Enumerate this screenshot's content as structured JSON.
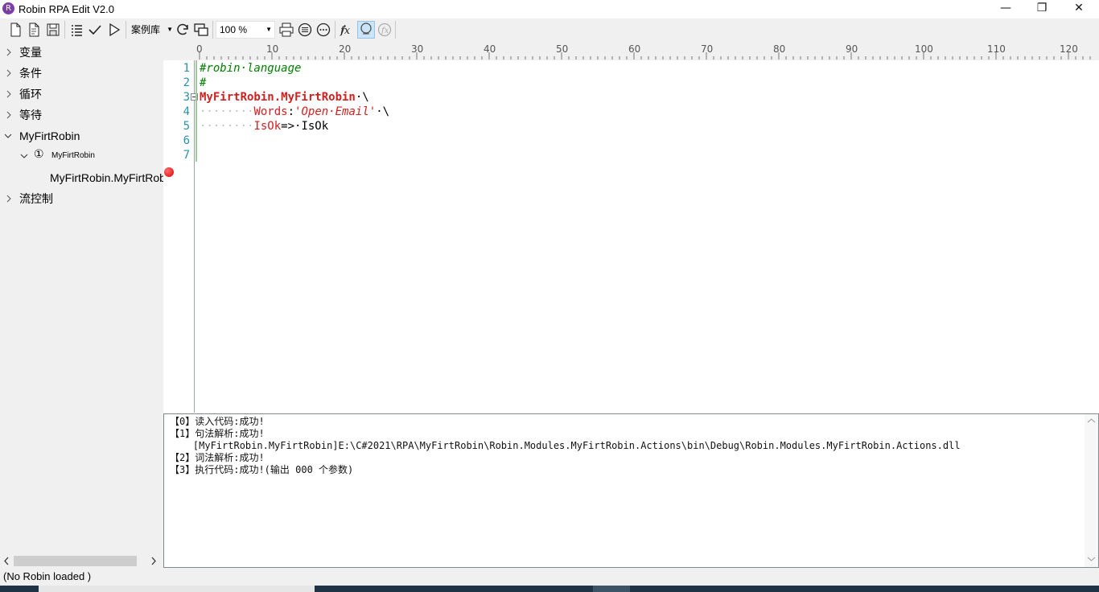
{
  "window": {
    "app_icon_letter": "R",
    "title": "Robin RPA Edit V2.0",
    "min_glyph": "—",
    "max_glyph": "❐",
    "close_glyph": "✕"
  },
  "toolbar": {
    "icons": [
      "new-file-icon",
      "new-document-icon",
      "save-icon",
      "list-icon",
      "check-icon",
      "run-icon",
      "refresh-icon",
      "screen-capture-icon",
      "print-icon",
      "menu-circle-icon",
      "more-circle-icon",
      "function-icon",
      "cursor-active-icon",
      "function-disabled-icon"
    ],
    "cases_label": "案例库",
    "zoom_value": "100 %"
  },
  "tree": {
    "items": [
      {
        "label": "变量",
        "expanded": false
      },
      {
        "label": "条件",
        "expanded": false
      },
      {
        "label": "循环",
        "expanded": false
      },
      {
        "label": "等待",
        "expanded": false
      },
      {
        "label": "MyFirtRobin",
        "expanded": true
      },
      {
        "label": "MyFirtRobin",
        "expanded": true,
        "badge": "①"
      },
      {
        "label": "MyFirtRobin.MyFirtRobin"
      },
      {
        "label": "流控制",
        "expanded": false
      }
    ]
  },
  "ruler": {
    "ticks": [
      "0",
      "10",
      "20",
      "30",
      "40",
      "50",
      "60",
      "70",
      "80",
      "90",
      "100",
      "110",
      "120"
    ]
  },
  "editor": {
    "line_numbers": [
      "1",
      "2",
      "3",
      "4",
      "5",
      "6",
      "7"
    ],
    "lines": {
      "l1": "#robin·language",
      "l2": "#",
      "l3_kw": "MyFirtRobin.MyFirtRobin",
      "l3_rest": "·\\",
      "l4_indent": "········",
      "l4_param": "Words",
      "l4_colon": ":",
      "l4_str": "'Open·Email'",
      "l4_rest": "·\\",
      "l5_indent": "········",
      "l5_param": "IsOk",
      "l5_rest": "=>·IsOk"
    },
    "breakpoint_line": 7
  },
  "output": {
    "lines": [
      "【0】读入代码:成功!",
      "【1】句法解析:成功!",
      "    [MyFirtRobin.MyFirtRobin]E:\\C#2021\\RPA\\MyFirtRobin\\Robin.Modules.MyFirtRobin.Actions\\bin\\Debug\\Robin.Modules.MyFirtRobin.Actions.dll",
      "【2】词法解析:成功!",
      "【3】执行代码:成功!(输出 000 个参数)"
    ]
  },
  "status": {
    "text": "(No Robin loaded )"
  }
}
